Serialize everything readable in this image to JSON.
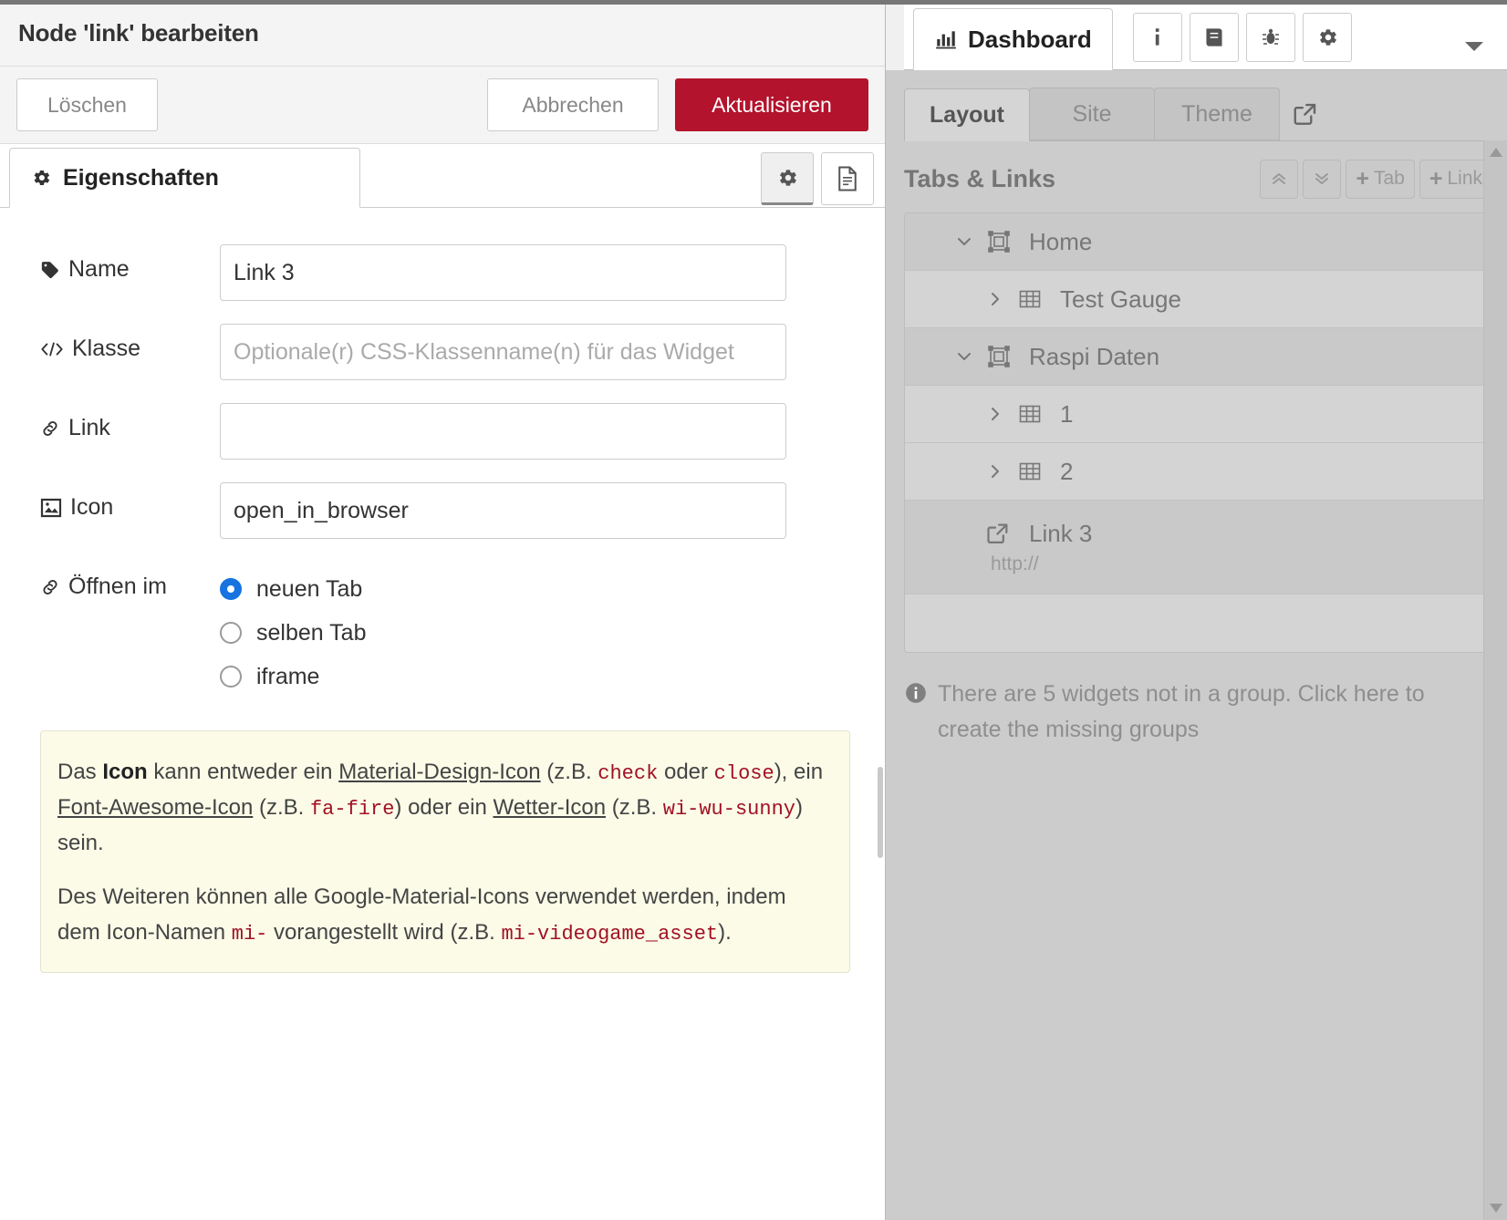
{
  "editor": {
    "title": "Node 'link' bearbeiten",
    "buttons": {
      "delete": "Löschen",
      "cancel": "Abbrechen",
      "update": "Aktualisieren"
    },
    "tabs": {
      "properties": "Eigenschaften"
    },
    "icons": {
      "properties_tab": "gear-icon",
      "settings_toggle": "gear-icon",
      "description_toggle": "document-icon"
    },
    "fields": [
      {
        "key": "name",
        "label": "Name",
        "icon": "tag-icon",
        "value": "Link 3",
        "placeholder": ""
      },
      {
        "key": "klasse",
        "label": "Klasse",
        "icon": "code-icon",
        "value": "",
        "placeholder": "Optionale(r) CSS-Klassenname(n) für das Widget"
      },
      {
        "key": "link",
        "label": "Link",
        "icon": "link-icon",
        "value": "",
        "placeholder": ""
      },
      {
        "key": "icon",
        "label": "Icon",
        "icon": "image-icon",
        "value": "open_in_browser",
        "placeholder": ""
      }
    ],
    "open_in": {
      "label": "Öffnen im",
      "icon": "link-icon",
      "options": [
        {
          "label": "neuen Tab",
          "checked": true
        },
        {
          "label": "selben Tab",
          "checked": false
        },
        {
          "label": "iframe",
          "checked": false
        }
      ]
    },
    "help": {
      "p1": {
        "t1": "Das ",
        "b1": "Icon",
        "t2": " kann entweder ein ",
        "u1": "Material-Design-Icon",
        "t3": " (z.B. ",
        "c1": "check",
        "t4": " oder ",
        "c2": "close",
        "t5": "), ein ",
        "u2": "Font-Awesome-Icon",
        "t6": " (z.B. ",
        "c3": "fa-fire",
        "t7": ") oder ein ",
        "u3": "Wetter-Icon",
        "t8": " (z.B. ",
        "c4": "wi-wu-sunny",
        "t9": ") sein."
      },
      "p2": {
        "t1": "Des Weiteren können alle Google-Material-Icons verwendet werden, indem dem Icon-Namen ",
        "c1": "mi-",
        "t2": " vorangestellt wird (z.B. ",
        "c2": "mi-videogame_asset",
        "t3": ")."
      }
    }
  },
  "sidebar": {
    "main_tab": {
      "label": "Dashboard",
      "icon": "bar-chart-icon"
    },
    "header_icons": [
      {
        "name": "info-icon",
        "glyph": "i"
      },
      {
        "name": "book-icon",
        "glyph": "book"
      },
      {
        "name": "bug-icon",
        "glyph": "bug"
      },
      {
        "name": "gear-icon",
        "glyph": "gear"
      }
    ],
    "header_caret": "chevron-down-icon",
    "subtabs": [
      {
        "label": "Layout",
        "active": true
      },
      {
        "label": "Site",
        "active": false
      },
      {
        "label": "Theme",
        "active": false
      }
    ],
    "open_external_icon": "open-external-icon",
    "tabs_links": {
      "title": "Tabs & Links",
      "buttons": [
        {
          "name": "collapse-all-button",
          "label": "",
          "icon": "chevron-double-up-icon"
        },
        {
          "name": "expand-all-button",
          "label": "",
          "icon": "chevron-double-down-icon"
        },
        {
          "name": "add-tab-button",
          "label": "Tab",
          "icon": "plus-icon"
        },
        {
          "name": "add-link-button",
          "label": "Link",
          "icon": "plus-icon"
        }
      ],
      "tree": [
        {
          "type": "group",
          "label": "Home",
          "expanded": true,
          "icon": "tab-group-icon"
        },
        {
          "type": "child",
          "label": "Test Gauge",
          "expanded": false,
          "icon": "grid-icon"
        },
        {
          "type": "group",
          "label": "Raspi Daten",
          "expanded": true,
          "icon": "tab-group-icon"
        },
        {
          "type": "child",
          "label": "1",
          "expanded": false,
          "icon": "grid-icon"
        },
        {
          "type": "child",
          "label": "2",
          "expanded": false,
          "icon": "grid-icon"
        },
        {
          "type": "link",
          "label": "Link 3",
          "sub": "http://",
          "icon": "open-external-icon"
        }
      ]
    },
    "note": {
      "icon": "info-icon",
      "text": "There are 5 widgets not in a group. Click here to create the missing groups"
    }
  },
  "colors": {
    "accent_red": "#b3132c",
    "radio_blue": "#1673e0",
    "code_red": "#a11122",
    "help_bg": "#fbfbe8",
    "sidebar_bg": "#cccccc"
  }
}
